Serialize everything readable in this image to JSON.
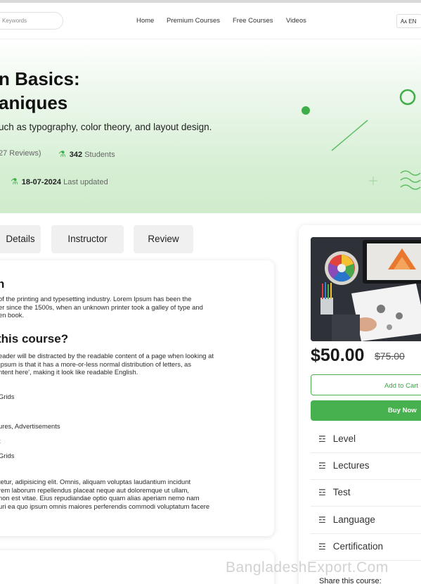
{
  "header": {
    "search_placeholder": "Keywords",
    "nav": [
      "Home",
      "Premium Courses",
      "Free Courses",
      "Videos"
    ],
    "lang": "EN",
    "lang_icon": "translate-icon"
  },
  "hero": {
    "title_line1": "n Basics:",
    "title_line2": "aniques",
    "subtitle": "uch as typography, color theory, and layout design.",
    "reviews": "27 Reviews)",
    "students_count": "342",
    "students_label": "Students",
    "updated_date": "18-07-2024",
    "updated_label": "Last updated",
    "accent": "#3fae49"
  },
  "tabs": [
    "Details",
    "Instructor",
    "Review"
  ],
  "content": {
    "heading1": "n",
    "para1": [
      "of the printing and typesetting industry. Lorem Ipsum has been the",
      "er since the 1500s, when an unknown printer took a galley of type and",
      "en book."
    ],
    "heading2": " this course?",
    "para2": [
      "eader will be distracted by the readable content of a page when looking at",
      "Ipsum is that it has a more-or-less normal distribution of letters, as",
      "ntent here', making it look like readable English."
    ],
    "list": [
      "Grids",
      "ures, Advertisements",
      "t",
      "Grids"
    ],
    "para3": [
      "tetur, adipisicing elit. Omnis, aliquam voluptas laudantium incidunt",
      "rem laborum repellendus placeat neque aut doloremque ut ullam,",
      "non est vitae. Eius repudiandae optio quam alias aperiam nemo nam",
      "uri ea quo ipsum omnis maiores perferendis commodi voluptatum facere"
    ]
  },
  "sidebar": {
    "price": "$50.00",
    "old_price": "$75.00",
    "add_to_cart": "Add to Cart",
    "buy_now": "Buy Now",
    "info_items": [
      "Level",
      "Lectures",
      "Test",
      "Language",
      "Certification"
    ],
    "share": "Share this course:"
  },
  "watermark": "BangladeshExport.Com"
}
